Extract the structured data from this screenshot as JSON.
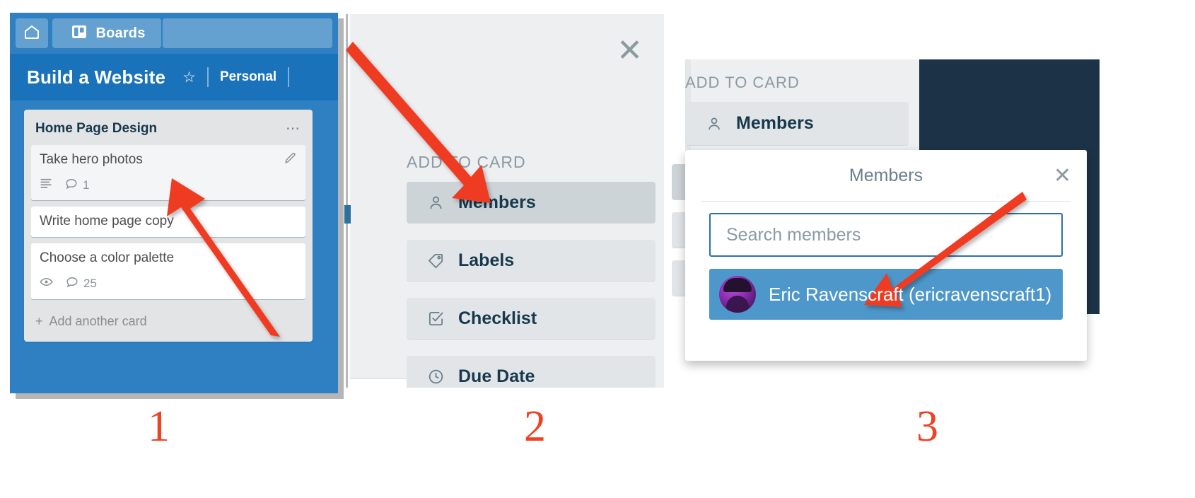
{
  "panel1": {
    "topbar": {
      "home_icon": "home-icon",
      "boards_icon": "trello-boards-icon",
      "boards_label": "Boards"
    },
    "board_header": {
      "title": "Build a Website",
      "star_icon": "star-icon",
      "visibility_label": "Personal"
    },
    "list": {
      "title": "Home Page Design",
      "menu_icon": "ellipsis-icon",
      "add_card_label": "Add another card",
      "add_card_icon": "plus-icon",
      "cards": [
        {
          "title": "Take hero photos",
          "edit_icon": "pencil-icon",
          "badges": [
            {
              "icon": "description-icon",
              "value": ""
            },
            {
              "icon": "comment-icon",
              "value": "1"
            }
          ]
        },
        {
          "title": "Write home page copy",
          "edit_icon": "",
          "badges": []
        },
        {
          "title": "Choose a color palette",
          "edit_icon": "",
          "badges": [
            {
              "icon": "eye-icon",
              "value": ""
            },
            {
              "icon": "comment-icon",
              "value": "25"
            }
          ]
        }
      ]
    }
  },
  "panel2": {
    "close_icon": "close-icon",
    "section_label": "ADD TO CARD",
    "buttons": [
      {
        "label": "Members",
        "icon": "person-icon",
        "active": true
      },
      {
        "label": "Labels",
        "icon": "tag-icon",
        "active": false
      },
      {
        "label": "Checklist",
        "icon": "checkbox-icon",
        "active": false
      },
      {
        "label": "Due Date",
        "icon": "clock-icon",
        "active": false
      }
    ]
  },
  "panel3": {
    "section_label": "ADD TO CARD",
    "members_button": {
      "label": "Members",
      "icon": "person-icon"
    },
    "popup": {
      "title": "Members",
      "close_icon": "close-icon",
      "search_placeholder": "Search members",
      "search_value": "",
      "results": [
        {
          "avatar": "avatar-eric",
          "name": "Eric Ravenscraft (ericravenscraft1)",
          "selected": true
        }
      ]
    }
  },
  "annotations": {
    "accent_color": "#ef4123",
    "steps": [
      {
        "label": "1"
      },
      {
        "label": "2"
      },
      {
        "label": "3"
      }
    ]
  }
}
